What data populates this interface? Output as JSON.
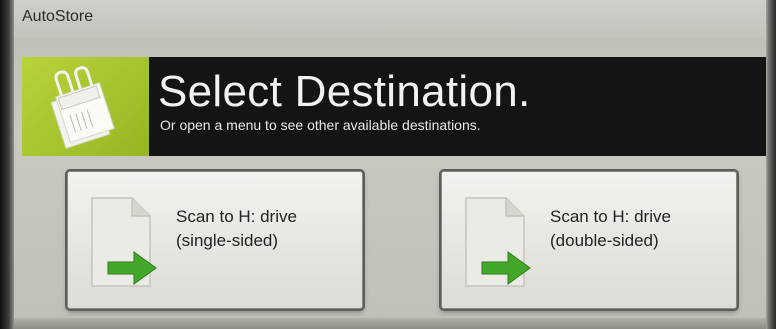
{
  "app": {
    "title": "AutoStore"
  },
  "header": {
    "title": "Select Destination.",
    "subtitle": "Or open a menu to see other available destinations.",
    "icon": "paper-clip-documents-icon",
    "accent_color": "#a8c82e"
  },
  "destinations": [
    {
      "line1": "Scan to H: drive",
      "line2": "(single-sided)",
      "icon": "document-arrow-icon"
    },
    {
      "line1": "Scan to H: drive",
      "line2": "(double-sided)",
      "icon": "document-arrow-icon"
    }
  ]
}
